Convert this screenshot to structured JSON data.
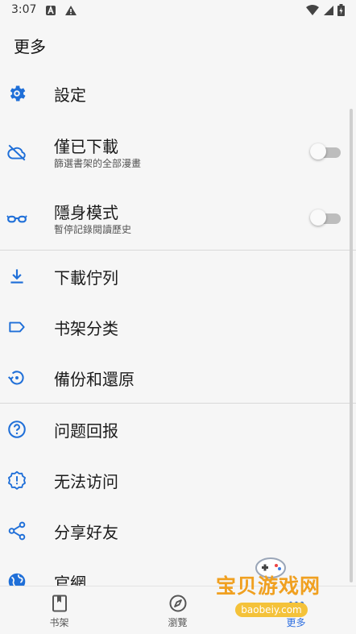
{
  "status_bar": {
    "time": "3:07"
  },
  "header": {
    "title": "更多"
  },
  "menu": {
    "settings": {
      "title": "設定"
    },
    "downloaded_only": {
      "title": "僅已下載",
      "subtitle": "篩選書架的全部漫畫",
      "enabled": false
    },
    "incognito": {
      "title": "隱身模式",
      "subtitle": "暫停記錄閱讀歷史",
      "enabled": false
    },
    "download_queue": {
      "title": "下載佇列"
    },
    "categories": {
      "title": "书架分类"
    },
    "backup": {
      "title": "備份和還原"
    },
    "report": {
      "title": "问题回报"
    },
    "no_access": {
      "title": "无法访问"
    },
    "share": {
      "title": "分享好友"
    },
    "website": {
      "title": "官網"
    }
  },
  "bottom_nav": {
    "library": {
      "label": "书架"
    },
    "browse": {
      "label": "瀏覽"
    },
    "more": {
      "label": "更多"
    }
  },
  "watermark": {
    "text": "宝贝游戏网",
    "url": "baobeiy.com"
  },
  "colors": {
    "accent": "#2f6fe0",
    "icon_blue": "#1f6fd8",
    "background": "#f6f6f6",
    "divider": "#d9d9d9"
  }
}
